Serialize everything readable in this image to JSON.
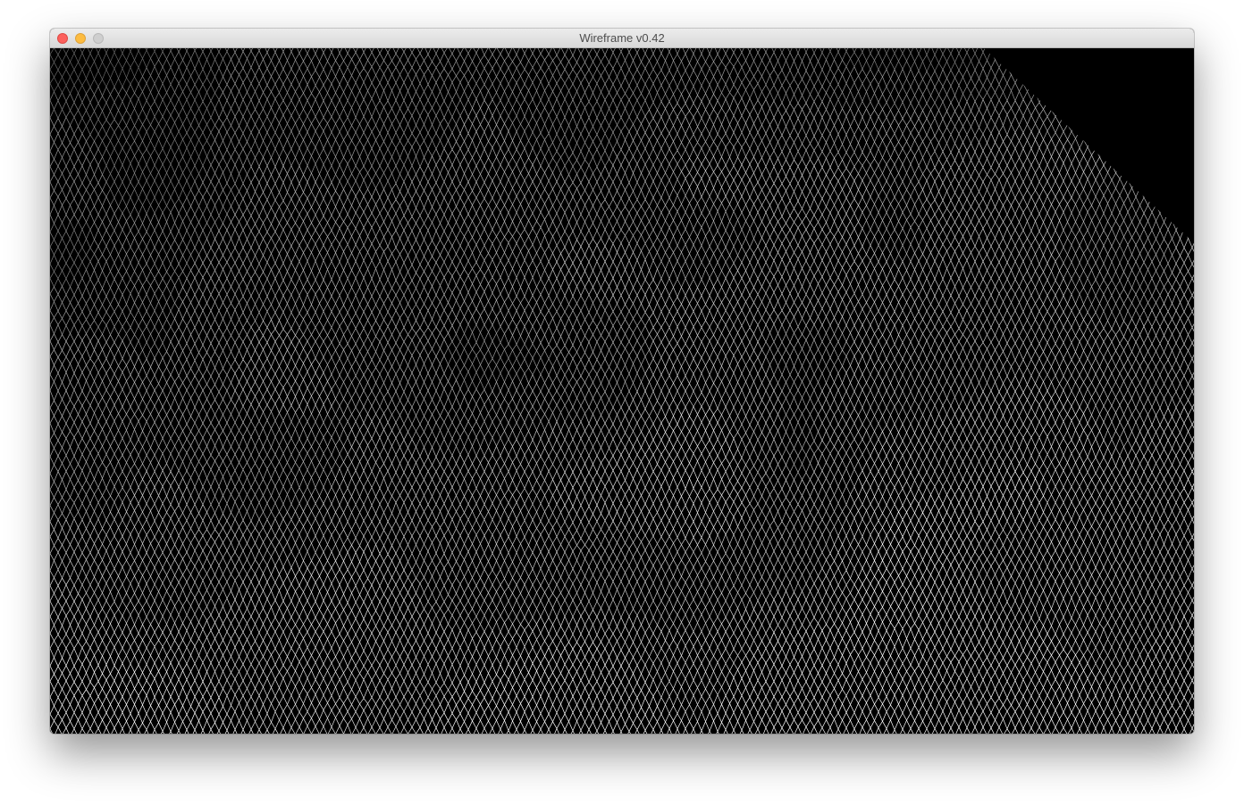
{
  "window": {
    "title": "Wireframe v0.42"
  },
  "viewport": {
    "content": "wireframe-terrain-mesh",
    "background_color": "#000000",
    "line_color": "#ffffff"
  },
  "colors": {
    "close": "#fc605c",
    "minimize": "#fdbc40",
    "zoom_disabled": "#cfcfcf"
  }
}
